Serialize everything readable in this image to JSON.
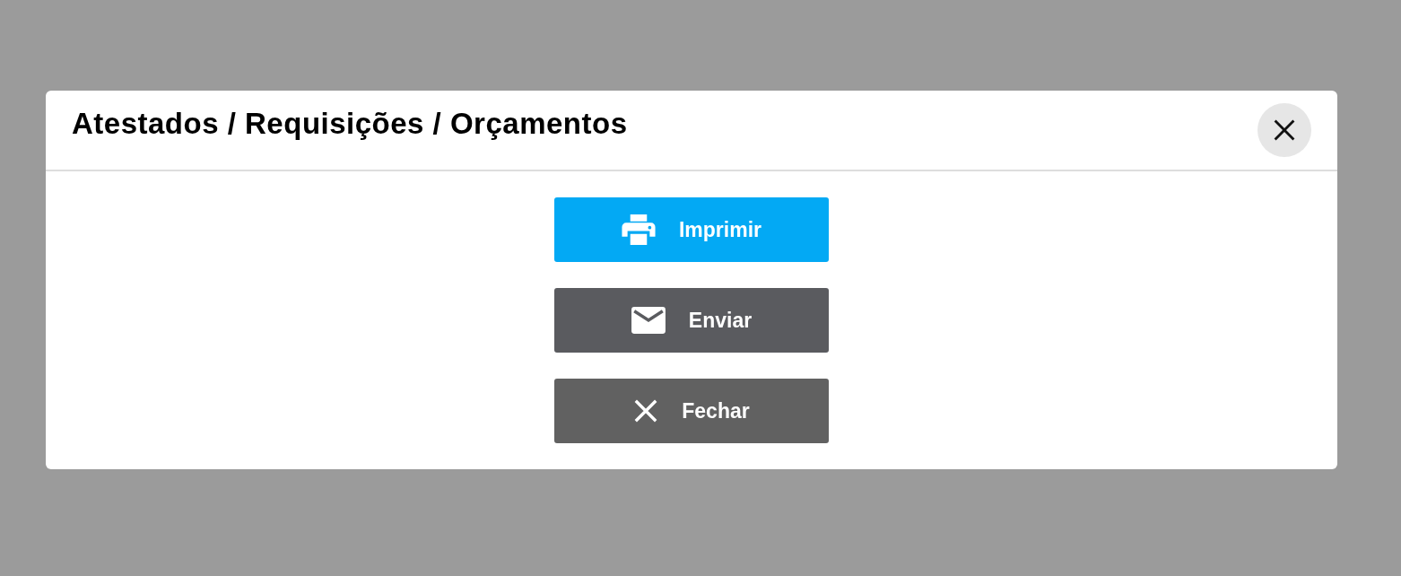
{
  "dialog": {
    "title": "Atestados / Requisições / Orçamentos",
    "buttons": [
      {
        "kind": "print",
        "label": "Imprimir",
        "color": "#03a9f4"
      },
      {
        "kind": "send",
        "label": "Enviar",
        "color": "#5a5b5f"
      },
      {
        "kind": "close",
        "label": "Fechar",
        "color": "#616161"
      }
    ]
  }
}
